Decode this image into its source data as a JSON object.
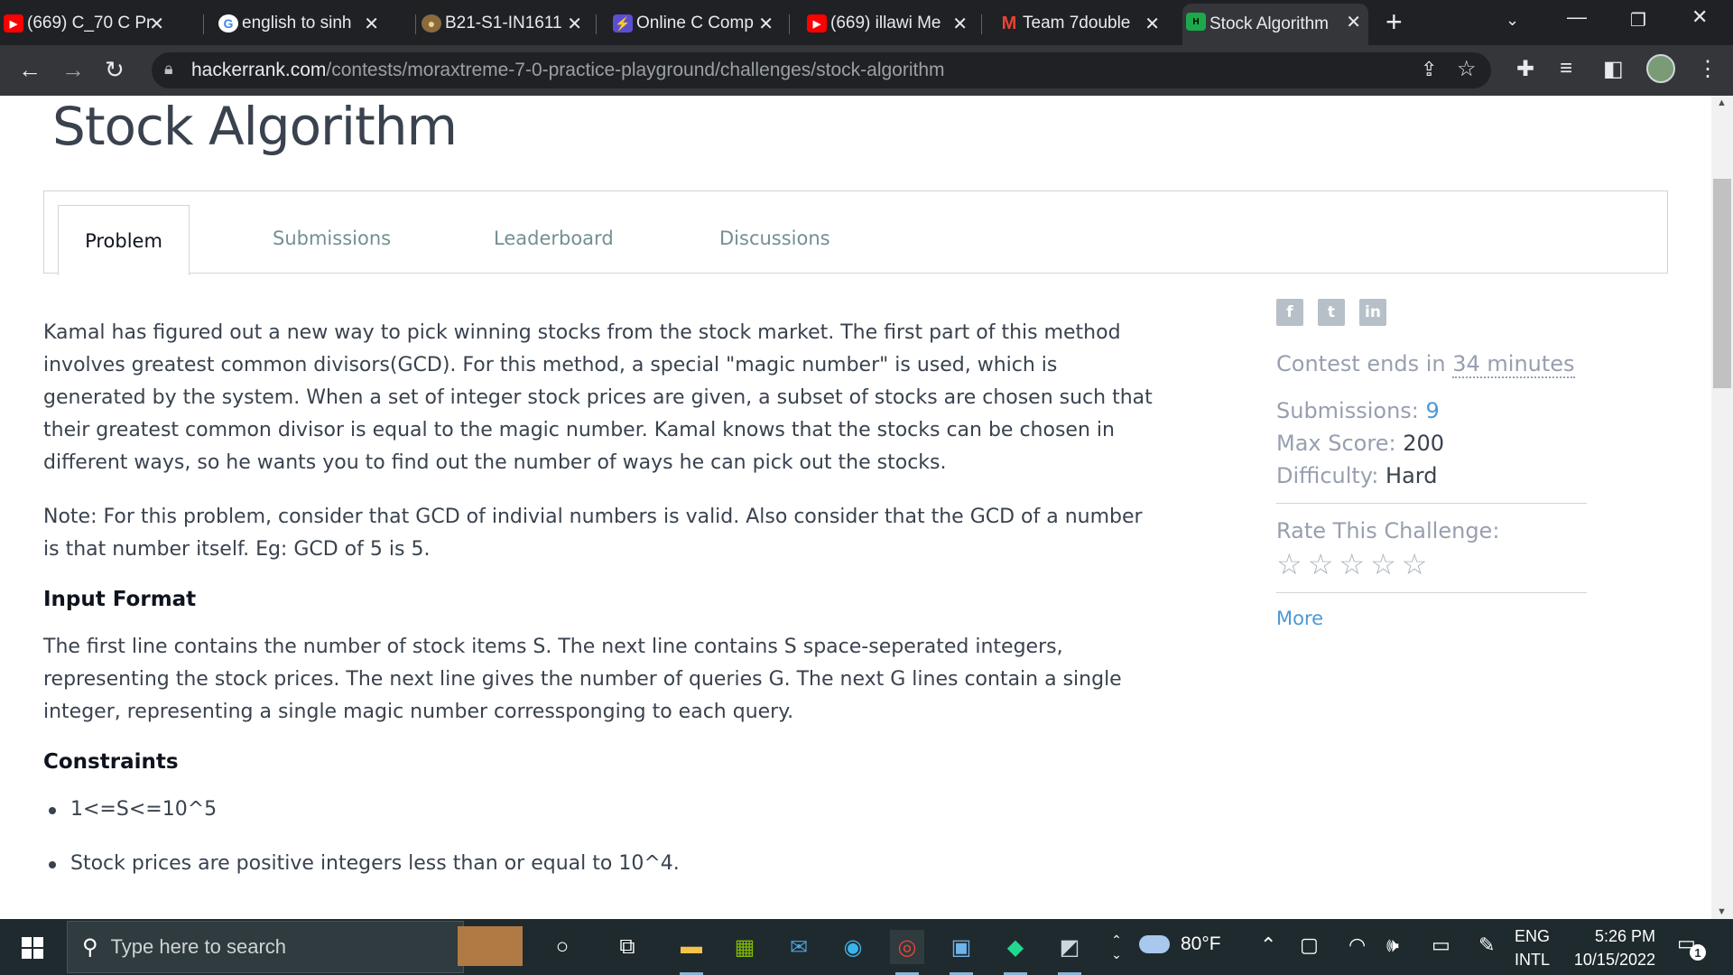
{
  "browser": {
    "tabs": [
      {
        "title": "(669) C_70 C Pr",
        "icon": "youtube-icon",
        "color": "#ff0000"
      },
      {
        "title": "english to sinh",
        "icon": "google-icon",
        "color": "#ffffff"
      },
      {
        "title": "B21-S1-IN1611",
        "icon": "emblem-icon",
        "color": "#8b6a3e"
      },
      {
        "title": "Online C Comp",
        "icon": "bolt-icon",
        "color": "#5b4fd0"
      },
      {
        "title": "(669) illawi Me",
        "icon": "youtube-icon",
        "color": "#ff0000"
      },
      {
        "title": "Team 7double",
        "icon": "gmail-icon",
        "color": "#ea4335"
      },
      {
        "title": "Stock Algorithm",
        "icon": "hackerrank-icon",
        "color": "#1ba94c"
      }
    ],
    "url_host": "hackerrank.com",
    "url_path": "/contests/moraxtreme-7-0-practice-playground/challenges/stock-algorithm"
  },
  "page": {
    "title": "Stock Algorithm",
    "tabs": [
      "Problem",
      "Submissions",
      "Leaderboard",
      "Discussions"
    ],
    "problem_paragraphs": [
      "Kamal has figured out a new way to pick winning stocks from the stock market. The first part of this method involves greatest common divisors(GCD). For this method, a special \"magic number\" is used, which is generated by the system. When a set of integer stock prices are given, a subset of stocks are chosen such that their greatest common divisor is equal to the magic number. Kamal knows that the stocks can be chosen in different ways, so he wants you to find out the number of ways he can pick out the stocks.",
      "Note: For this problem, consider that GCD of indivial numbers is valid. Also consider that the GCD of a number is that number itself. Eg: GCD of 5 is 5."
    ],
    "input_format_heading": "Input Format",
    "input_format_text": "The first line contains the number of stock items S. The next line contains S space-seperated integers, representing the stock prices. The next line gives the number of queries G. The next G lines contain a single integer, representing a single magic number corressponging to each query.",
    "constraints_heading": "Constraints",
    "constraints": [
      "1<=S<=10^5",
      "Stock prices are positive integers less than or equal to 10^4."
    ]
  },
  "sidebar": {
    "social": [
      "f",
      "t",
      "in"
    ],
    "contest_prefix": "Contest ends in ",
    "contest_remaining": "34 minutes",
    "submissions_label": "Submissions:",
    "submissions_value": "9",
    "max_score_label": "Max Score:",
    "max_score_value": "200",
    "difficulty_label": "Difficulty:",
    "difficulty_value": "Hard",
    "rate_label": "Rate This Challenge:",
    "rating": 0,
    "more_label": "More"
  },
  "taskbar": {
    "search_placeholder": "Type here to search",
    "temperature": "80°F",
    "lang_top": "ENG",
    "lang_bottom": "INTL",
    "time": "5:26 PM",
    "date": "10/15/2022",
    "notification_count": "1"
  }
}
